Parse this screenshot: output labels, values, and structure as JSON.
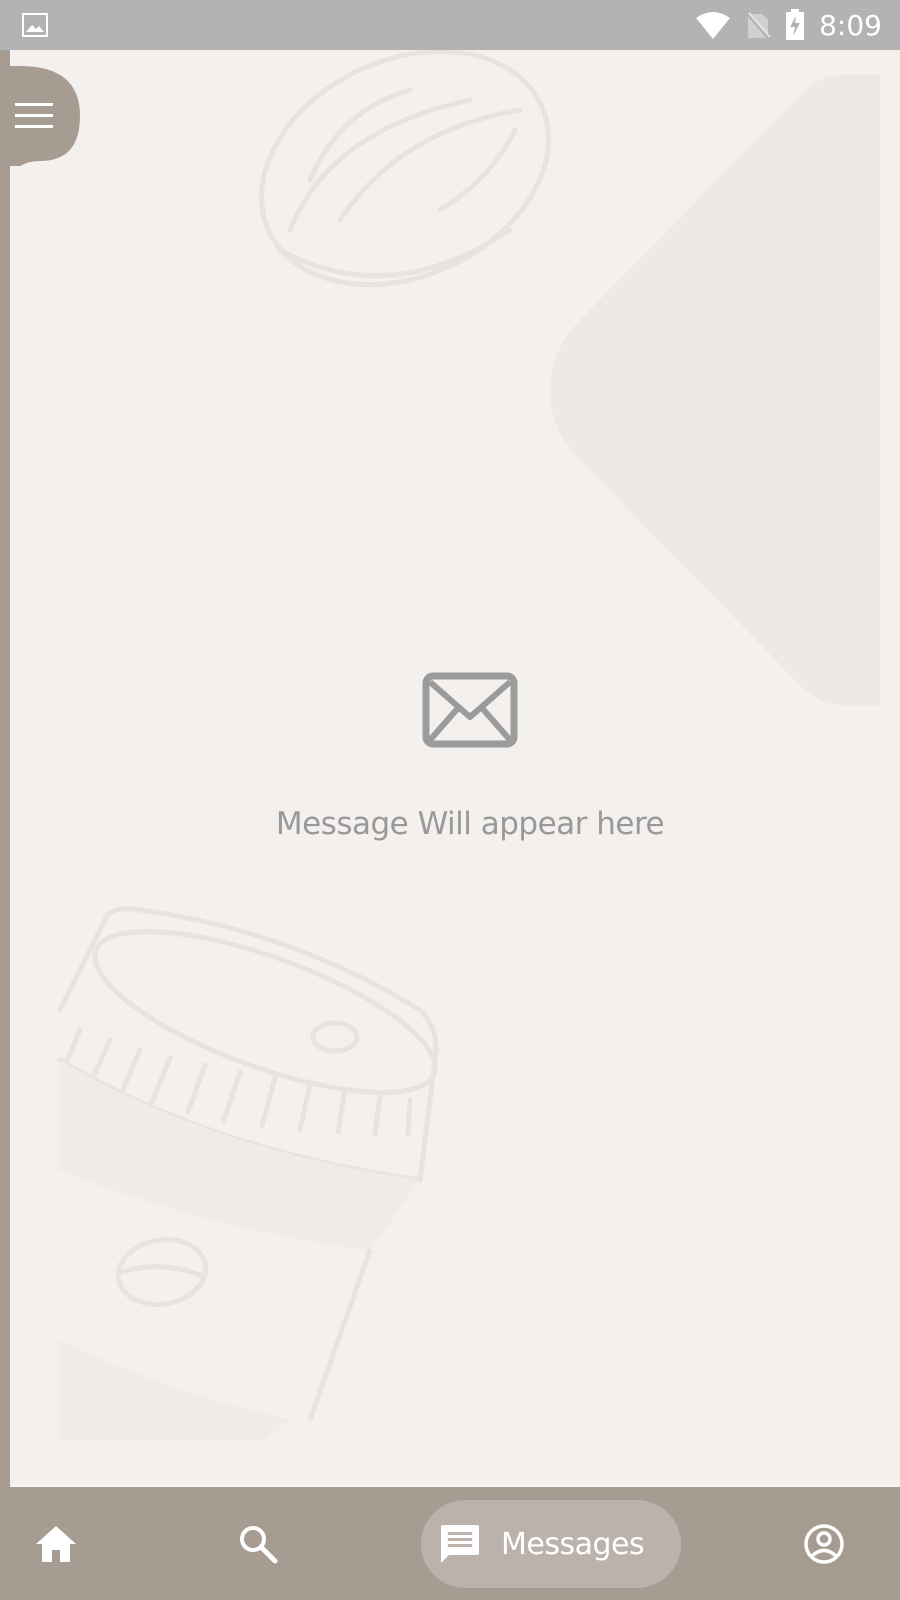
{
  "status_bar": {
    "time": "8:09",
    "icons": [
      "gallery-icon",
      "wifi-icon",
      "no-sim-icon",
      "battery-charging-icon"
    ]
  },
  "header": {
    "menu_icon": "menu-icon"
  },
  "empty_state": {
    "icon": "mail-icon",
    "message": "Message Will appear here"
  },
  "bottom_nav": {
    "items": [
      {
        "icon": "home-icon",
        "label": ""
      },
      {
        "icon": "search-icon",
        "label": ""
      },
      {
        "icon": "chat-icon",
        "label": "Messages",
        "active": true
      },
      {
        "icon": "account-circle-icon",
        "label": ""
      }
    ]
  },
  "colors": {
    "accent": "#a69c92",
    "active_pill": "#bbb3ab",
    "background": "#f3f0ee",
    "muted_text": "#999999",
    "status_bar": "#b3b3b3"
  }
}
